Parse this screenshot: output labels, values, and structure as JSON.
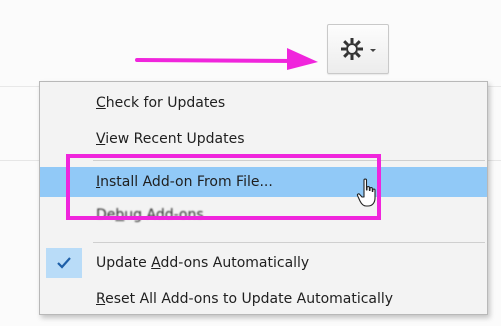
{
  "toolbar": {
    "gear_icon": "gear-icon",
    "chevron_icon": "chevron-down-icon",
    "annotation_color": "#f025dc"
  },
  "menu": {
    "items": [
      {
        "label_pre": "",
        "label_u": "C",
        "label_post": "heck for Updates"
      },
      {
        "label_pre": "",
        "label_u": "V",
        "label_post": "iew Recent Updates"
      },
      {
        "label_pre": "",
        "label_u": "I",
        "label_post": "nstall Add-on From File..."
      },
      {
        "label_pre": "De",
        "label_u": "b",
        "label_post": "ug Add-ons"
      },
      {
        "label_pre": "Update ",
        "label_u": "A",
        "label_post": "dd-ons Automatically",
        "checked": true
      },
      {
        "label_pre": "",
        "label_u": "R",
        "label_post": "eset All Add-ons to Update Automatically"
      }
    ],
    "highlight_color": "#91c9f7"
  }
}
